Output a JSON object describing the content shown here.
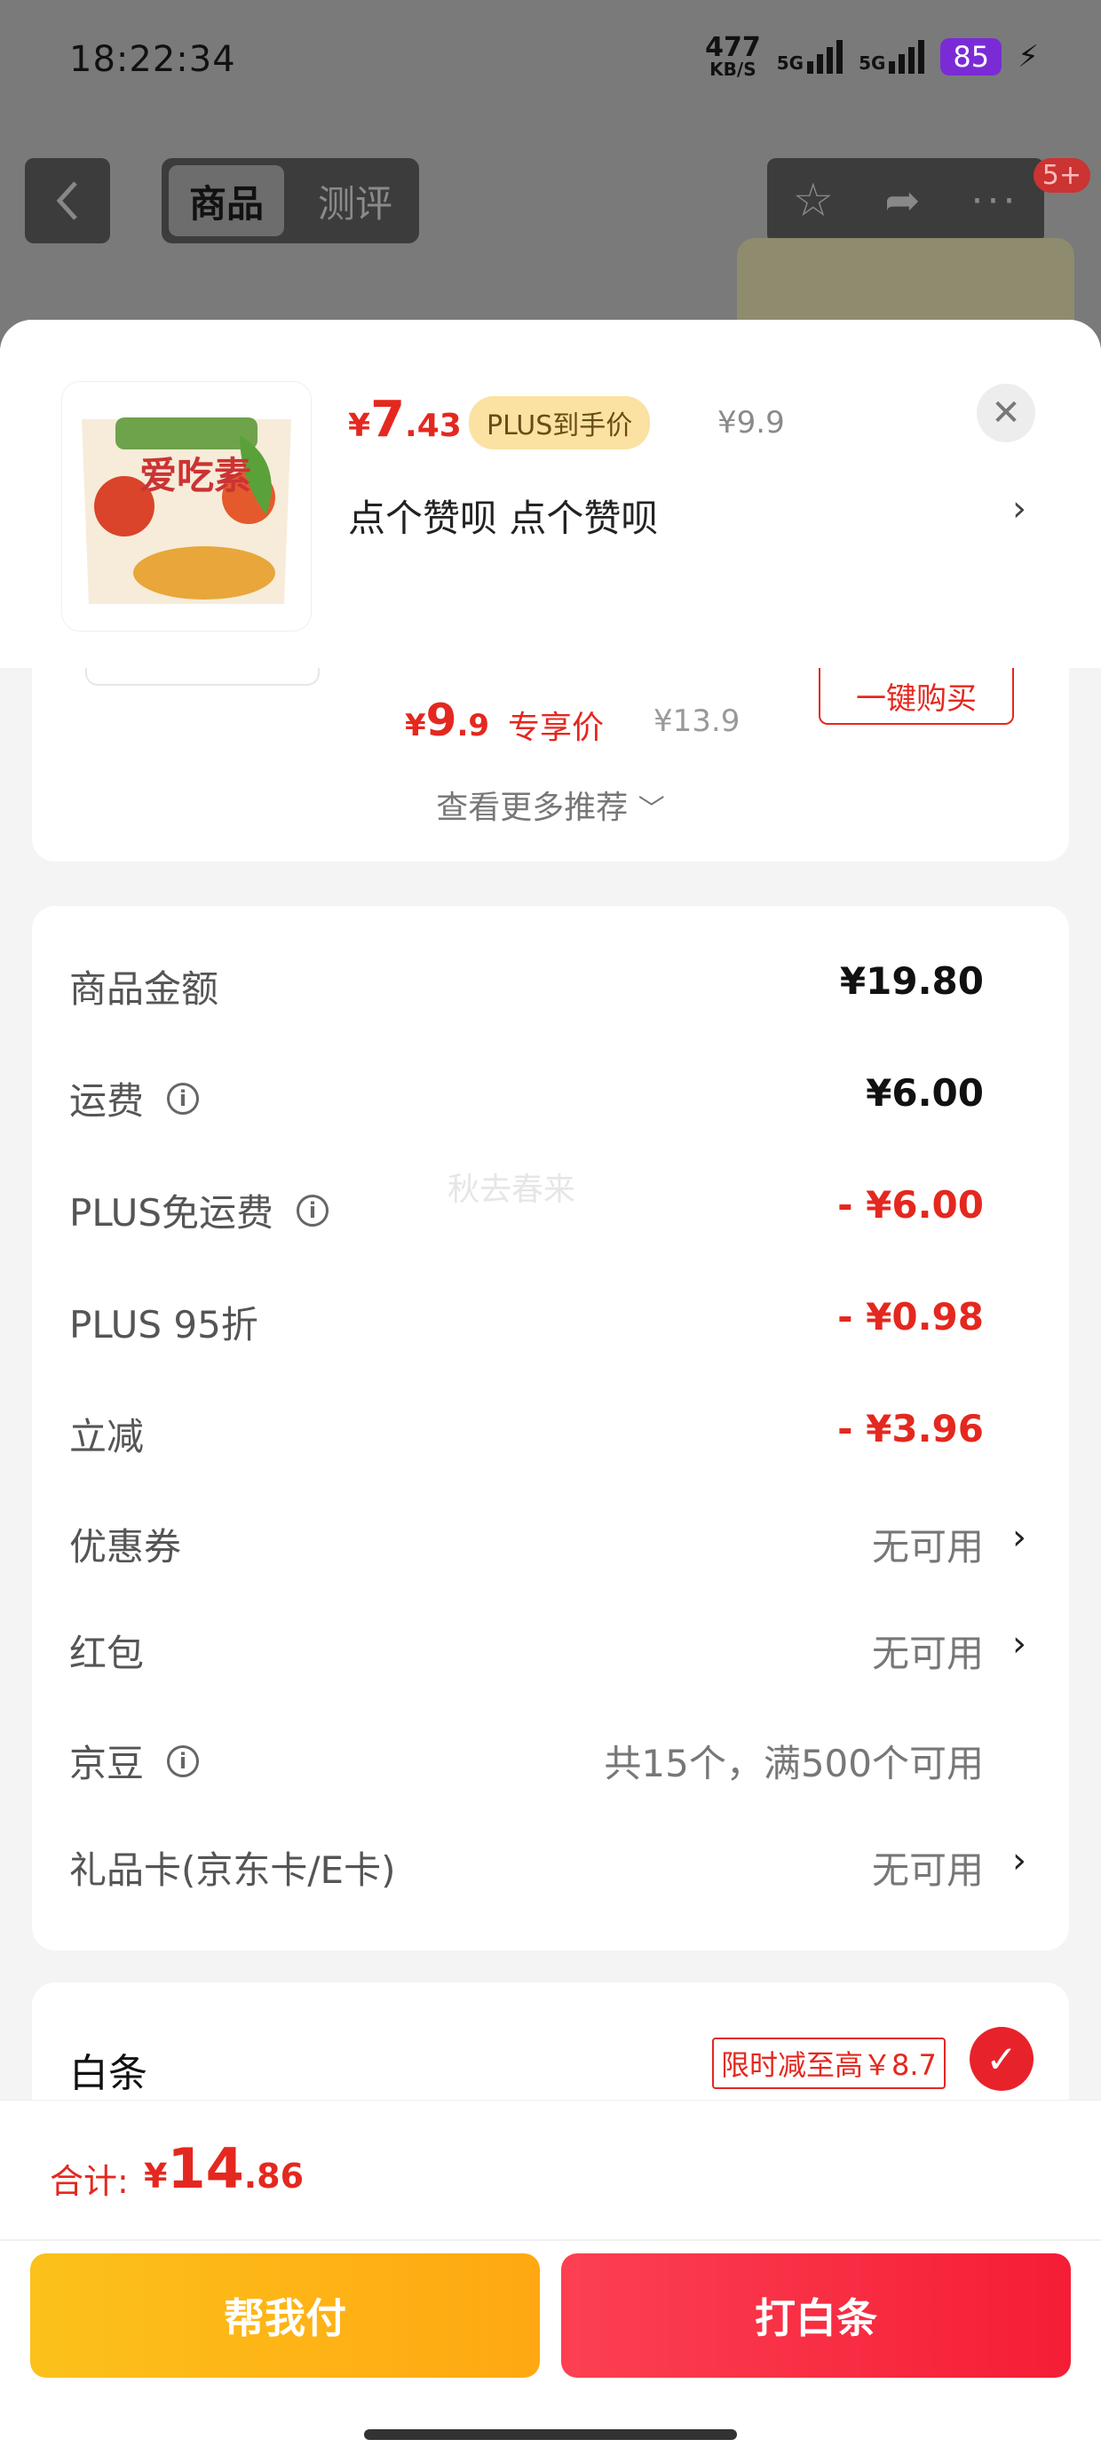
{
  "status_bar": {
    "time": "18:22:34",
    "net_speed_value": "477",
    "net_speed_unit": "KB/S",
    "sim1": "5G",
    "sim2": "5G",
    "battery": "85"
  },
  "nav": {
    "tab_goods": "商品",
    "tab_review": "测评",
    "notification_badge": "5+"
  },
  "product": {
    "price_symbol": "¥",
    "price_int": "7",
    "price_dec": ".43",
    "plus_tag": "PLUS到手价",
    "original_price": "¥9.9",
    "name": "点个赞呗  点个赞呗",
    "brand_text": "爱吃素"
  },
  "recommendation": {
    "price_symbol": "¥",
    "price_int": "9",
    "price_dec": ".9",
    "price_label": "专享价",
    "original_price": "¥13.9",
    "buy_label": "一键购买",
    "more_label": "查看更多推荐"
  },
  "fees": {
    "watermark": "秋去春来",
    "rows": [
      {
        "label": "商品金额",
        "value": "¥19.80"
      },
      {
        "label": "运费",
        "value": "¥6.00"
      },
      {
        "label": "PLUS免运费",
        "value": "- ¥6.00"
      },
      {
        "label": "PLUS 95折",
        "value": "- ¥0.98"
      },
      {
        "label": "立减",
        "value": "- ¥3.96"
      },
      {
        "label": "优惠券",
        "value": "无可用"
      },
      {
        "label": "红包",
        "value": "无可用"
      },
      {
        "label": "京豆",
        "value": "共15个，满500个可用"
      },
      {
        "label": "礼品卡(京东卡/E卡)",
        "value": "无可用"
      }
    ]
  },
  "payment": {
    "method": "白条",
    "promo": "限时减至高￥8.7"
  },
  "footer": {
    "total_label": "合计:",
    "total_symbol": "¥",
    "total_int": "14",
    "total_dec": ".86",
    "help_pay": "帮我付",
    "baitiao_pay": "打白条"
  },
  "colors": {
    "accent_red": "#e4281f",
    "help_button": "#fcc11b",
    "baitiao_button": "#f51d36"
  }
}
